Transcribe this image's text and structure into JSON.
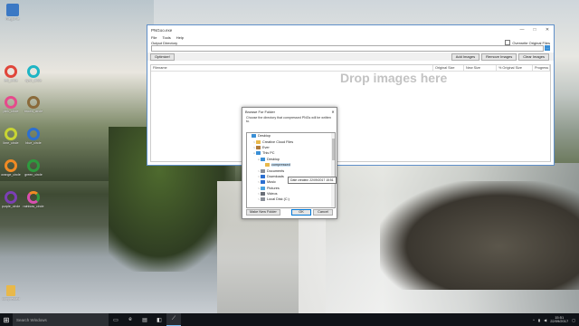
{
  "desktop": {
    "icons": [
      {
        "label": "RiegoFile",
        "color": "#3b78c4"
      },
      {
        "label": "red_circle",
        "color": "#e0463a"
      },
      {
        "label": "cyan_circle",
        "color": "#1fb5c4"
      },
      {
        "label": "pink_circle",
        "color": "#e54b8c"
      },
      {
        "label": "brown_circle",
        "color": "#8a6a3a"
      },
      {
        "label": "lime_circle",
        "color": "#c8d433"
      },
      {
        "label": "blue_circle",
        "color": "#2c6fd1"
      },
      {
        "label": "orange_circle",
        "color": "#f08a24"
      },
      {
        "label": "green_circle",
        "color": "#2e9a3e"
      },
      {
        "label": "purple_circle",
        "color": "#7b3fb3"
      },
      {
        "label": "rainbow_circle",
        "color": "#d94fb0"
      },
      {
        "label": "compressed",
        "color": "#e8b84a"
      }
    ]
  },
  "app": {
    "title": "PNGoo.exe",
    "menu": [
      "File",
      "Tools",
      "Help"
    ],
    "output_label": "Output Directory",
    "overwrite_label": "Overwrite Original Files",
    "browse_label": "...",
    "optimize_label": "Optimize!",
    "add_label": "Add Images",
    "remove_label": "Remove Images",
    "clear_label": "Clear Images",
    "columns": [
      "Filename",
      "Original Size",
      "New Size",
      "% Original Size",
      "Progress"
    ],
    "drop_hint": "Drop images here"
  },
  "dialog": {
    "title": "Browse For Folder",
    "description": "Choose the directory that compressed PNGs will be written to.",
    "tree": [
      {
        "label": "Desktop",
        "level": 0,
        "expander": "",
        "color": "#3a8fd6"
      },
      {
        "label": "Creative Cloud Files",
        "level": 1,
        "expander": ">",
        "color": "#e8b84a"
      },
      {
        "label": "Ever",
        "level": 1,
        "expander": ">",
        "color": "#b07a3a"
      },
      {
        "label": "This PC",
        "level": 1,
        "expander": "v",
        "color": "#3a8fd6"
      },
      {
        "label": "Desktop",
        "level": 2,
        "expander": "v",
        "color": "#3a8fd6"
      },
      {
        "label": "compressed",
        "level": 3,
        "expander": "",
        "color": "#e8b84a"
      },
      {
        "label": "Documents",
        "level": 2,
        "expander": ">",
        "color": "#8a8f98"
      },
      {
        "label": "Downloads",
        "level": 2,
        "expander": ">",
        "color": "#2c6fd1"
      },
      {
        "label": "Music",
        "level": 2,
        "expander": ">",
        "color": "#2c6fd1"
      },
      {
        "label": "Pictures",
        "level": 2,
        "expander": ">",
        "color": "#4aa3e0"
      },
      {
        "label": "Videos",
        "level": 2,
        "expander": ">",
        "color": "#6a6f78"
      },
      {
        "label": "Local Disk (C:)",
        "level": 2,
        "expander": ">",
        "color": "#8a8f98"
      }
    ],
    "tooltip": "Date created: 22/09/2017 15:51",
    "new_folder_label": "Make New Folder",
    "ok_label": "OK",
    "cancel_label": "Cancel"
  },
  "taskbar": {
    "search_placeholder": "Search Windows",
    "time": "15:51",
    "date": "22/09/2017"
  }
}
